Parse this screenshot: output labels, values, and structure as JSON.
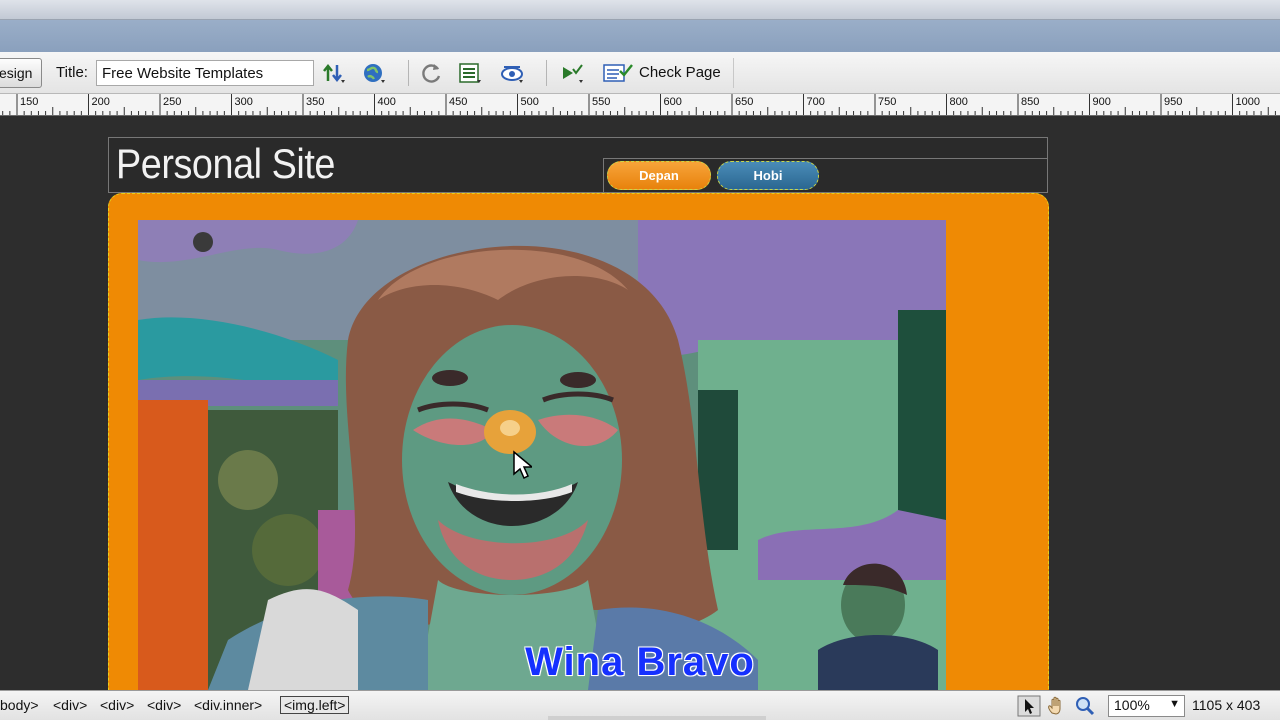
{
  "toolbar": {
    "design_label": "esign",
    "title_label": "Title:",
    "title_value": "Free Website Templates",
    "check_page_label": "Check Page",
    "icons": [
      "file-management-icon",
      "preview-globe-icon",
      "refresh-icon",
      "view-options-icon",
      "visual-aids-icon",
      "validate-markup-icon",
      "check-page-icon"
    ]
  },
  "ruler": {
    "labels": [
      "150",
      "200",
      "250",
      "300",
      "350",
      "400",
      "450",
      "500",
      "550",
      "600",
      "650",
      "700",
      "750",
      "800",
      "850",
      "900",
      "950",
      "1000"
    ]
  },
  "site": {
    "title": "Personal Site",
    "nav": [
      {
        "label": "Depan",
        "color": "#ef8a04"
      },
      {
        "label": "Hobi",
        "color": "#2b6791"
      }
    ],
    "accent_color": "#ef8a04"
  },
  "caption": "Wina Bravo",
  "statusbar": {
    "tags": [
      "body>",
      "<div>",
      "<div>",
      "<div>",
      "<div.inner>",
      "<img.left>"
    ],
    "zoom": "100%",
    "dimensions": "1105 x 403"
  }
}
